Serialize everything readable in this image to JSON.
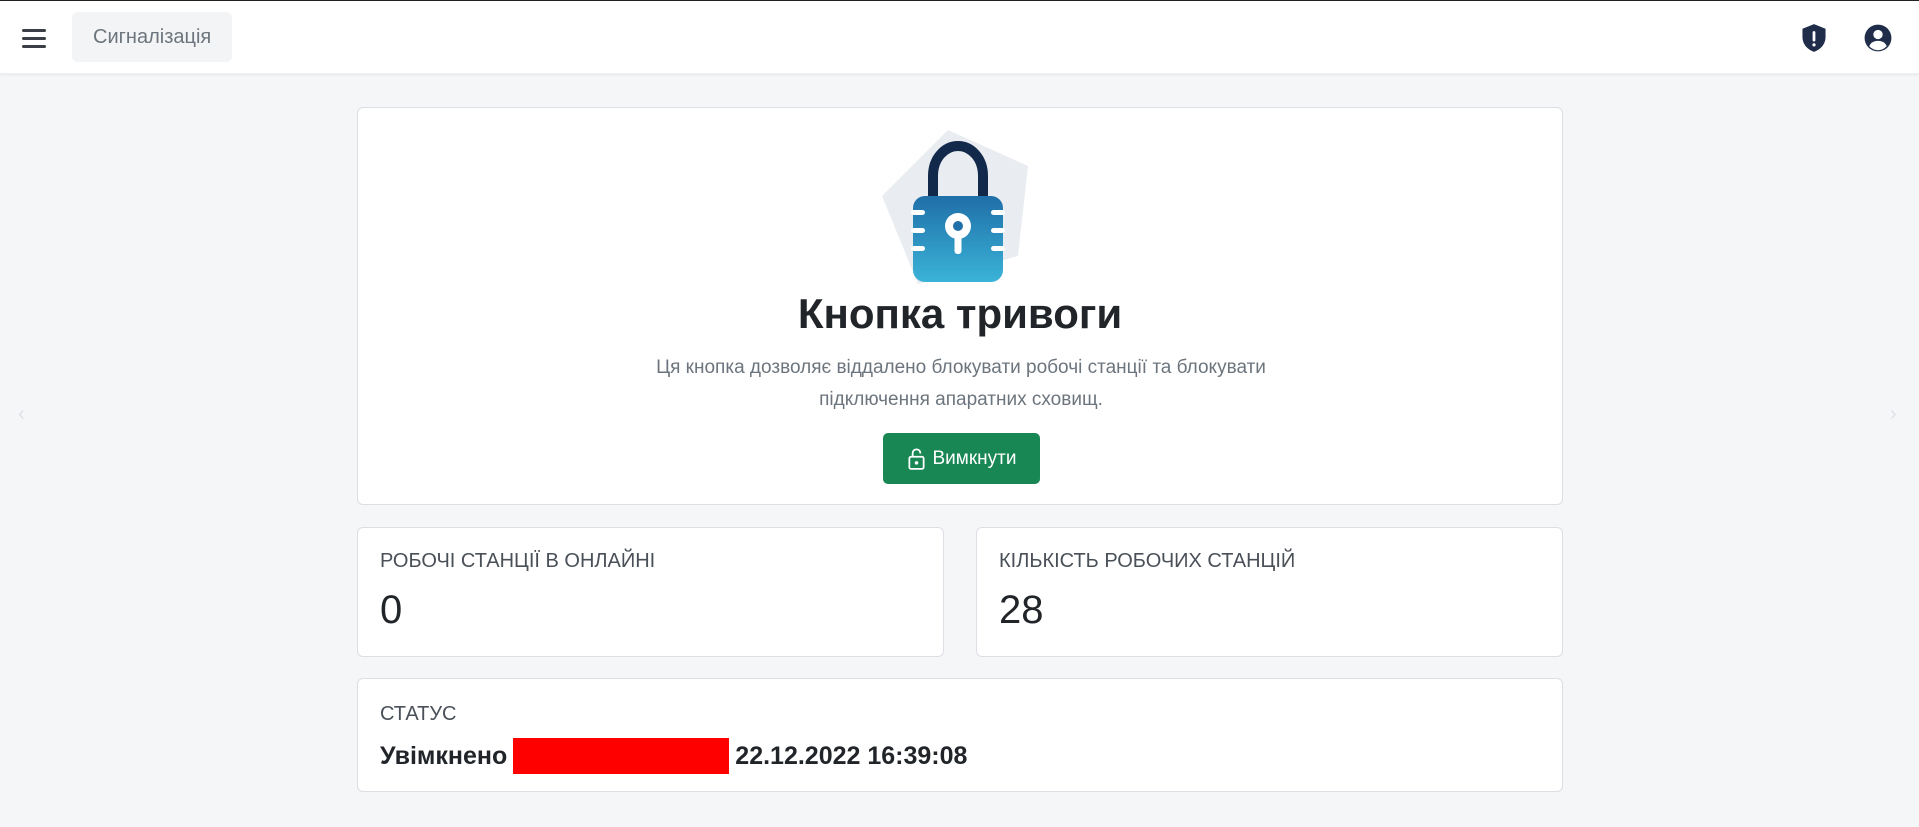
{
  "header": {
    "page_title": "Сигналізація",
    "icons": [
      "menu-icon",
      "shield-alert-icon",
      "user-circle-icon"
    ]
  },
  "hero": {
    "title": "Кнопка тривоги",
    "description": "Ця кнопка дозволяє віддалено блокувати робочі станції та блокувати підключення апаратних сховищ.",
    "button_label": "Вимкнути",
    "button_icon": "unlock-icon"
  },
  "stats": {
    "online": {
      "label": "РОБОЧІ СТАНЦІЇ В ОНЛАЙНІ",
      "value": "0"
    },
    "total": {
      "label": "КІЛЬКІСТЬ РОБОЧИХ СТАНЦІЙ",
      "value": "28"
    }
  },
  "status": {
    "label": "СТАТУС",
    "state": "Увімкнено",
    "timestamp": "22.12.2022 16:39:08"
  },
  "carousel": {
    "prev": "‹",
    "next": "›"
  },
  "colors": {
    "accent_green": "#198754",
    "redaction": "#ff0000",
    "background": "#f4f6f8"
  }
}
